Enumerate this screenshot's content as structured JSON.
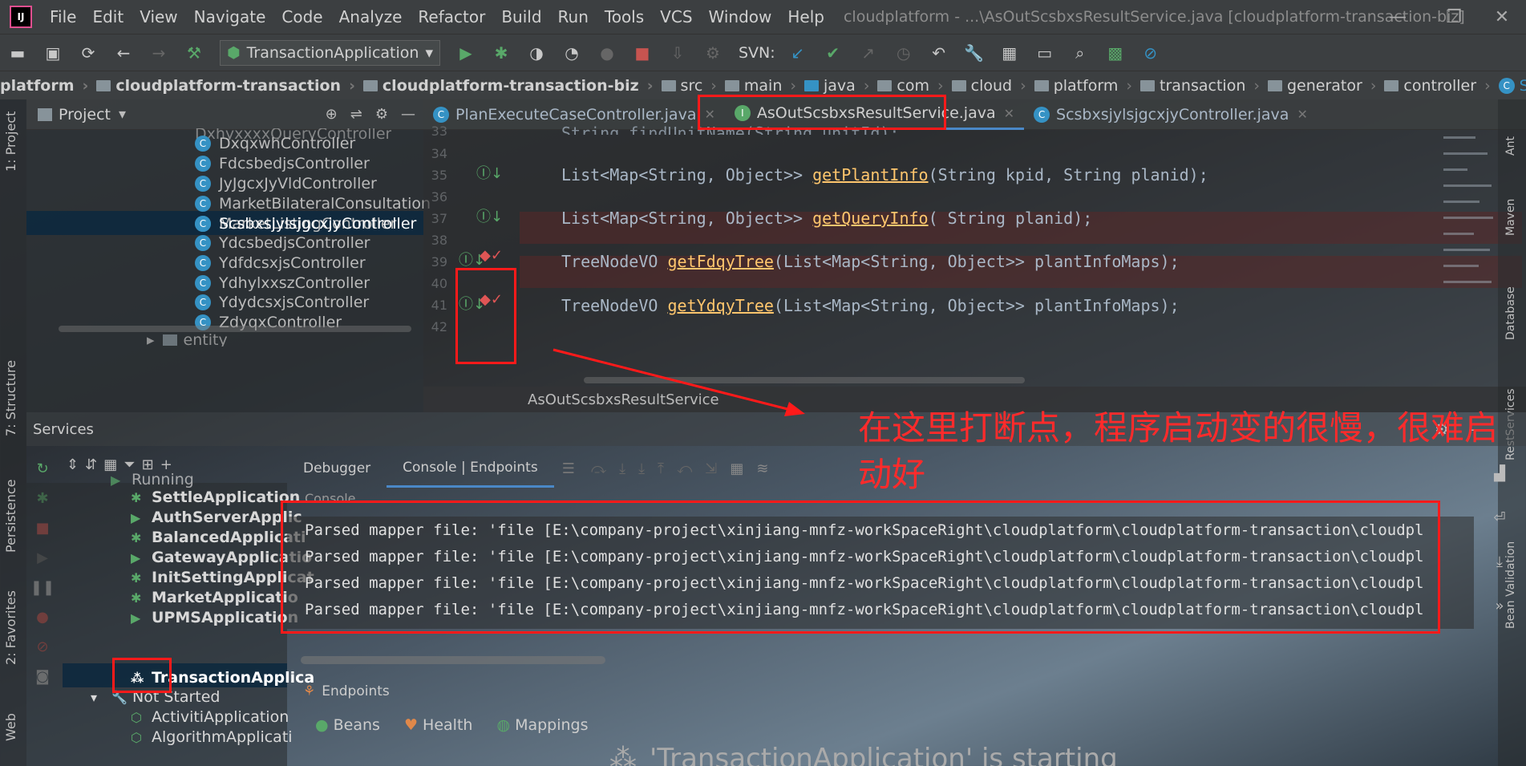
{
  "menu": {
    "items": [
      "File",
      "Edit",
      "View",
      "Navigate",
      "Code",
      "Analyze",
      "Refactor",
      "Build",
      "Run",
      "Tools",
      "VCS",
      "Window",
      "Help"
    ],
    "window_title": "cloudplatform - ...\\AsOutScsbxsResultService.java [cloudplatform-transaction-biz]"
  },
  "toolbar": {
    "run_config": "TransactionApplication",
    "svn_label": "SVN:"
  },
  "breadcrumb": {
    "items": [
      "platform",
      "cloudplatform-transaction",
      "cloudplatform-transaction-biz",
      "src",
      "main",
      "java",
      "com",
      "cloud",
      "platform",
      "transaction",
      "generator",
      "controller",
      "ScsbxsjylsjgcxjyController"
    ]
  },
  "left_strip": {
    "labels": [
      "1: Project",
      "7: Structure",
      "Persistence",
      "2: Favorites",
      "Web"
    ]
  },
  "project": {
    "title": "Project",
    "items": [
      "DxqxwhController",
      "FdcsbedjsController",
      "JyJgcxJyVldController",
      "MarketBilateralConsultation",
      "MarketListingController",
      "ScsbxsjylsjgcxjyController",
      "YdcsbedjsController",
      "YdfdcsxjsController",
      "YdhylxxszController",
      "YdydcsxjsController",
      "ZdyqxController"
    ],
    "partial_top": "DxhyxxxxQueryController",
    "partial_bottom": "entity"
  },
  "editor": {
    "tabs": [
      {
        "label": "PlanExecuteCaseController.java",
        "kind": "class"
      },
      {
        "label": "AsOutScsbxsResultService.java",
        "kind": "interface"
      },
      {
        "label": "ScsbxsjylsjgcxjyController.java",
        "kind": "class"
      }
    ],
    "line_numbers": [
      "33",
      "34",
      "35",
      "36",
      "37",
      "38",
      "39",
      "40",
      "41",
      "42"
    ],
    "lines": {
      "l33": "String findUnitName(String unitId);",
      "l35_type": "List<Map<String, Object>> ",
      "l35_fn": "getPlantInfo",
      "l35_rest": "(String kpid, String planid);",
      "l37_type": "List<Map<String, Object>> ",
      "l37_fn": "getQueryInfo",
      "l37_rest": "( String planid);",
      "l39_type": "TreeNodeVO ",
      "l39_fn": "getFdqyTree",
      "l39_rest": "(List<Map<String, Object>> plantInfoMaps);",
      "l41_type": "TreeNodeVO ",
      "l41_fn": "getYdqyTree",
      "l41_rest": "(List<Map<String, Object>> plantInfoMaps);"
    },
    "status": "AsOutScsbxsResultService"
  },
  "services": {
    "title": "Services",
    "running_group": "Running",
    "running": [
      "SettleApplication",
      "AuthServerApplic",
      "BalancedApplicati",
      "GatewayApplicatio",
      "InitSettingApplicat",
      "MarketApplicatio",
      "UPMSApplication",
      "TransactionApplica"
    ],
    "not_started_group": "Not Started",
    "not_started": [
      "ActivitiApplication",
      "AlgorithmApplicati"
    ]
  },
  "debug_tabs": [
    "Debugger",
    "Console | Endpoints"
  ],
  "console": {
    "label": "Console",
    "lines": [
      "Parsed mapper file: 'file [E:\\company-project\\xinjiang-mnfz-workSpaceRight\\cloudplatform\\cloudplatform-transaction\\cloudpl",
      "Parsed mapper file: 'file [E:\\company-project\\xinjiang-mnfz-workSpaceRight\\cloudplatform\\cloudplatform-transaction\\cloudpl",
      "Parsed mapper file: 'file [E:\\company-project\\xinjiang-mnfz-workSpaceRight\\cloudplatform\\cloudplatform-transaction\\cloudpl",
      "Parsed mapper file: 'file [E:\\company-project\\xinjiang-mnfz-workSpaceRight\\cloudplatform\\cloudplatform-transaction\\cloudpl"
    ]
  },
  "endpoints": {
    "label": "Endpoints",
    "tabs": [
      "Beans",
      "Health",
      "Mappings"
    ]
  },
  "starting_message": "'TransactionApplication' is starting",
  "annotation": {
    "text": "在这里打断点，程序启动变的很慢，很难启动好",
    "color": "#ff2b2b"
  },
  "right_strip": {
    "labels": [
      "Ant",
      "Maven",
      "Database",
      "RestServices",
      "Bean Validation"
    ]
  }
}
